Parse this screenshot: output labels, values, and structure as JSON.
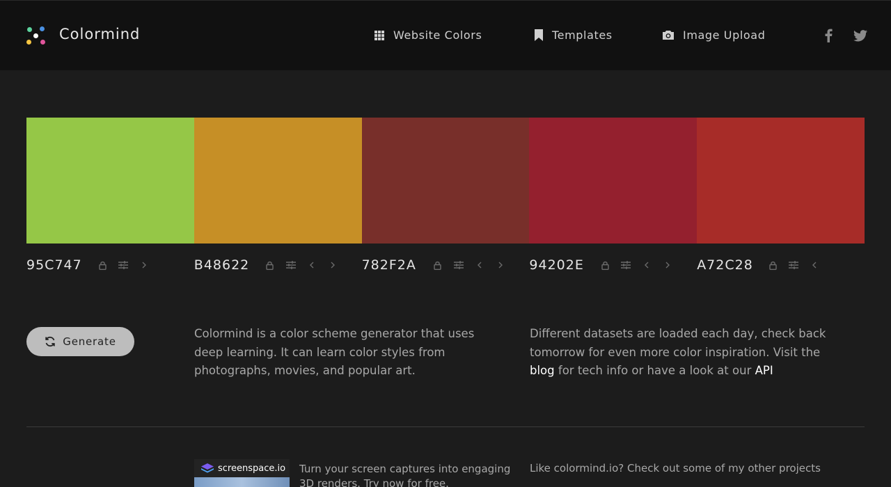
{
  "app": {
    "brand": "Colormind"
  },
  "nav": {
    "website_colors": "Website Colors",
    "templates": "Templates",
    "image_upload": "Image Upload"
  },
  "palette": [
    {
      "hex": "95C747",
      "color": "#95C747"
    },
    {
      "hex": "B48622",
      "color": "#C68F26"
    },
    {
      "hex": "782F2A",
      "color": "#782F2A"
    },
    {
      "hex": "94202E",
      "color": "#94202E"
    },
    {
      "hex": "A72C28",
      "color": "#A72C28"
    }
  ],
  "generate": {
    "label": "Generate"
  },
  "intro": {
    "text": "Colormind is a color scheme generator that uses deep learning. It can learn color styles from photographs, movies, and popular art."
  },
  "datasets": {
    "text_before": "Different datasets are loaded each day, check back tomorrow for even more color inspiration. Visit the ",
    "blog_link": "blog",
    "text_middle": " for tech info or have a look at our ",
    "api_link": "API"
  },
  "promo": {
    "logo_text": "screenspace.io",
    "text": "Turn your screen captures into engaging 3D renders. Try now for free."
  },
  "other_projects": "Like colormind.io? Check out some of my other projects"
}
